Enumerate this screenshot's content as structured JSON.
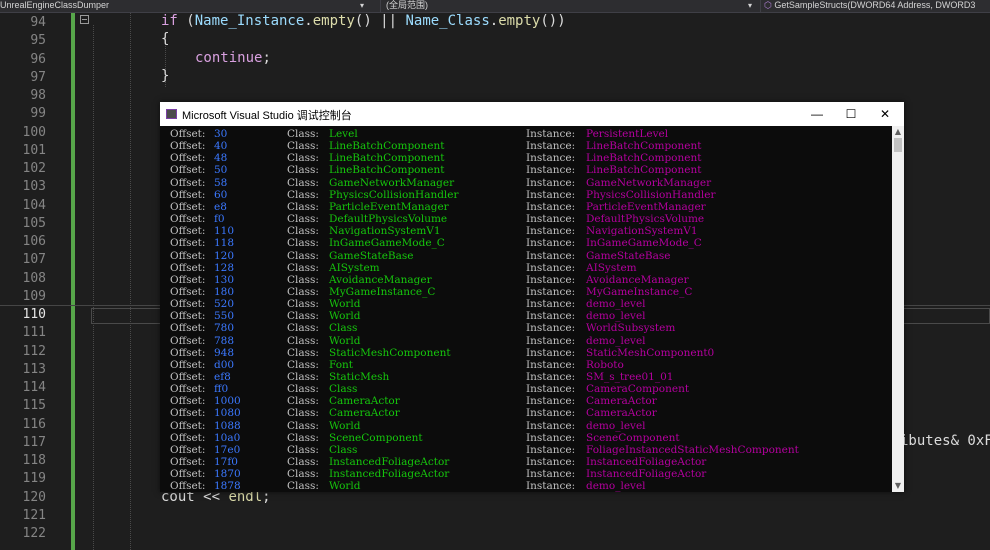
{
  "toolbar": {
    "project": "UnrealEngineClassDumper",
    "scope": "(全局范围)",
    "member": "GetSampleStructs(DWORD64 Address, DWORD3"
  },
  "editor": {
    "line_numbers": [
      "94",
      "95",
      "96",
      "97",
      "98",
      "99",
      "100",
      "101",
      "102",
      "103",
      "104",
      "105",
      "106",
      "107",
      "108",
      "109",
      "110",
      "111",
      "112",
      "113",
      "114",
      "115",
      "116",
      "117",
      "118",
      "119",
      "120",
      "121",
      "122"
    ],
    "current_line": "110",
    "code": {
      "if_kw": "if",
      "if_open": " (",
      "var1": "Name_Instance",
      "dot1": ".",
      "fn1": "empty",
      "mid": "() || ",
      "var2": "Name_Class",
      "dot2": ".",
      "fn2": "empty",
      "end": "())",
      "brace_open": "{",
      "continue_kw": "continue",
      "semi": ";",
      "brace_close": "}",
      "partial_right": "ibutes& 0xF",
      "cout": "cout",
      "op": " << ",
      "endl": "endl",
      "semi2": ";"
    }
  },
  "console": {
    "title": "Microsoft Visual Studio 调试控制台",
    "minimize": "—",
    "maximize": "☐",
    "close": "✕",
    "offset_label": "Offset:",
    "class_label": "Class:",
    "instance_label": "Instance:",
    "rows": [
      {
        "offset": "30",
        "class": "Level",
        "instance": "PersistentLevel"
      },
      {
        "offset": "40",
        "class": "LineBatchComponent",
        "instance": "LineBatchComponent"
      },
      {
        "offset": "48",
        "class": "LineBatchComponent",
        "instance": "LineBatchComponent"
      },
      {
        "offset": "50",
        "class": "LineBatchComponent",
        "instance": "LineBatchComponent"
      },
      {
        "offset": "58",
        "class": "GameNetworkManager",
        "instance": "GameNetworkManager"
      },
      {
        "offset": "60",
        "class": "PhysicsCollisionHandler",
        "instance": "PhysicsCollisionHandler"
      },
      {
        "offset": "e8",
        "class": "ParticleEventManager",
        "instance": "ParticleEventManager"
      },
      {
        "offset": "f0",
        "class": "DefaultPhysicsVolume",
        "instance": "DefaultPhysicsVolume"
      },
      {
        "offset": "110",
        "class": "NavigationSystemV1",
        "instance": "NavigationSystemV1"
      },
      {
        "offset": "118",
        "class": "InGameGameMode_C",
        "instance": "InGameGameMode_C"
      },
      {
        "offset": "120",
        "class": "GameStateBase",
        "instance": "GameStateBase"
      },
      {
        "offset": "128",
        "class": "AISystem",
        "instance": "AISystem"
      },
      {
        "offset": "130",
        "class": "AvoidanceManager",
        "instance": "AvoidanceManager"
      },
      {
        "offset": "180",
        "class": "MyGameInstance_C",
        "instance": "MyGameInstance_C"
      },
      {
        "offset": "520",
        "class": "World",
        "instance": "demo_level"
      },
      {
        "offset": "550",
        "class": "World",
        "instance": "demo_level"
      },
      {
        "offset": "780",
        "class": "Class",
        "instance": "WorldSubsystem"
      },
      {
        "offset": "788",
        "class": "World",
        "instance": "demo_level"
      },
      {
        "offset": "948",
        "class": "StaticMeshComponent",
        "instance": "StaticMeshComponent0"
      },
      {
        "offset": "d00",
        "class": "Font",
        "instance": "Roboto"
      },
      {
        "offset": "ef8",
        "class": "StaticMesh",
        "instance": "SM_s_tree01_01"
      },
      {
        "offset": "ff0",
        "class": "Class",
        "instance": "CameraComponent"
      },
      {
        "offset": "1000",
        "class": "CameraActor",
        "instance": "CameraActor"
      },
      {
        "offset": "1080",
        "class": "CameraActor",
        "instance": "CameraActor"
      },
      {
        "offset": "1088",
        "class": "World",
        "instance": "demo_level"
      },
      {
        "offset": "10a0",
        "class": "SceneComponent",
        "instance": "SceneComponent"
      },
      {
        "offset": "17e0",
        "class": "Class",
        "instance": "FoliageInstancedStaticMeshComponent"
      },
      {
        "offset": "17f0",
        "class": "InstancedFoliageActor",
        "instance": "InstancedFoliageActor"
      },
      {
        "offset": "1870",
        "class": "InstancedFoliageActor",
        "instance": "InstancedFoliageActor"
      },
      {
        "offset": "1878",
        "class": "World",
        "instance": "demo_level"
      }
    ]
  },
  "colors": {
    "offset": "#3b78ff",
    "class": "#16c60c",
    "instance": "#b4009e",
    "change_bar": "#57a64a"
  }
}
